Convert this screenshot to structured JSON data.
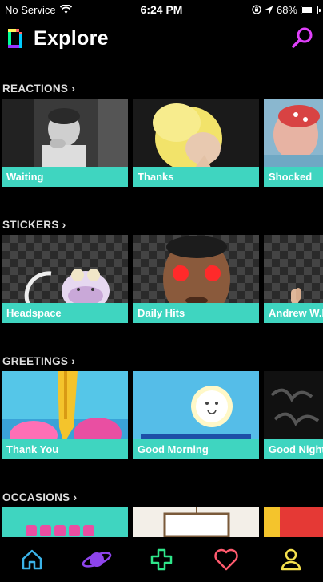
{
  "status": {
    "carrier": "No Service",
    "time": "6:24 PM",
    "battery": "68%",
    "battery_level": 0.68
  },
  "header": {
    "title": "Explore"
  },
  "sections": [
    {
      "title": "REACTIONS",
      "cards": [
        {
          "label": "Waiting"
        },
        {
          "label": "Thanks"
        },
        {
          "label": "Shocked"
        }
      ]
    },
    {
      "title": "STICKERS",
      "cards": [
        {
          "label": "Headspace"
        },
        {
          "label": "Daily Hits"
        },
        {
          "label": "Andrew W.K."
        }
      ]
    },
    {
      "title": "GREETINGS",
      "cards": [
        {
          "label": "Thank You"
        },
        {
          "label": "Good Morning"
        },
        {
          "label": "Good Night"
        }
      ]
    },
    {
      "title": "OCCASIONS",
      "cards": [
        {
          "label": ""
        },
        {
          "label": ""
        },
        {
          "label": ""
        }
      ]
    }
  ],
  "tabbar": {
    "items": [
      "home-icon",
      "planet-icon",
      "plus-icon",
      "heart-icon",
      "profile-icon"
    ]
  },
  "colors": {
    "accent_teal": "#3fd5c0",
    "search_magenta": "#e040fb"
  }
}
